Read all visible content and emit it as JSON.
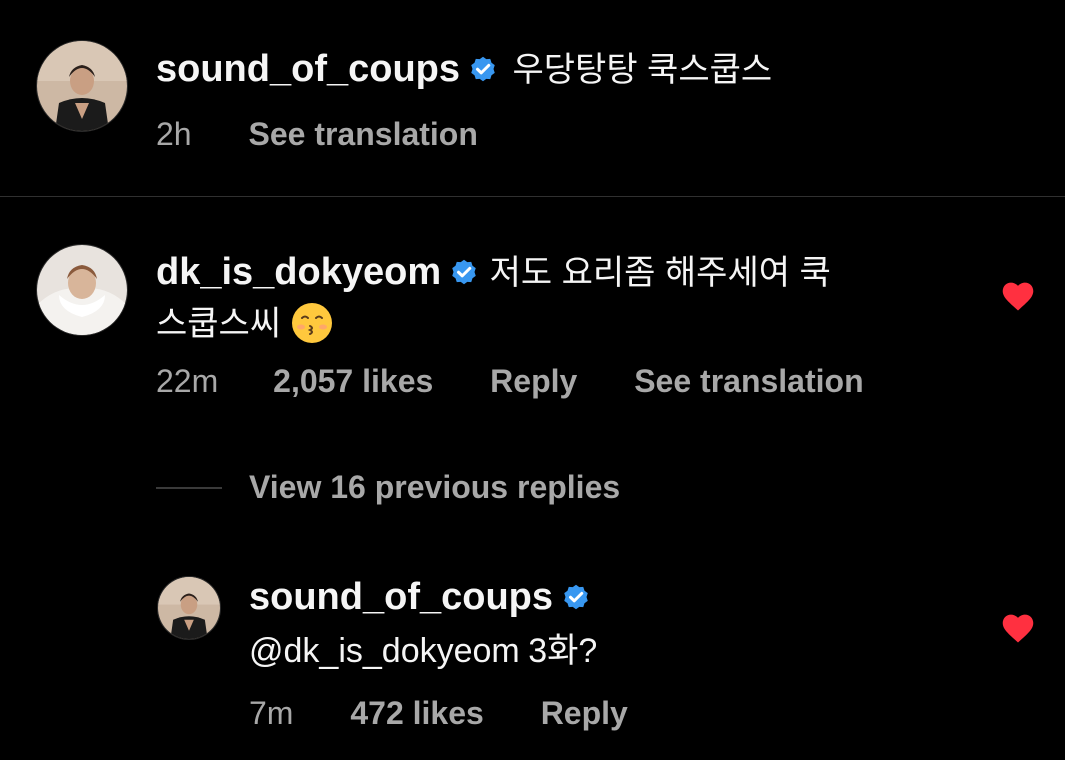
{
  "caption": {
    "username": "sound_of_coups",
    "text": "우당탕탕 쿡스쿱스",
    "time": "2h",
    "see_translation": "See translation",
    "avatar_icon": "avatar-person-icon",
    "verified_icon": "verified-badge-icon"
  },
  "comment": {
    "username": "dk_is_dokyeom",
    "text_line1": "저도 요리좀 해주세여 쿡",
    "text_line2": "스쿱스씨",
    "emoji": "kissing-face-emoji",
    "time": "22m",
    "likes": "2,057 likes",
    "reply": "Reply",
    "see_translation": "See translation",
    "liked": true
  },
  "view_replies": {
    "label": "View 16 previous replies"
  },
  "reply": {
    "username": "sound_of_coups",
    "mention": "@dk_is_dokyeom",
    "text": "3화?",
    "time": "7m",
    "likes": "472 likes",
    "reply": "Reply",
    "liked": true
  },
  "colors": {
    "background": "#000000",
    "text_primary": "#f5f5f5",
    "text_secondary": "#a8a8a8",
    "verified": "#3897f0",
    "heart": "#ff3040",
    "divider": "#303030"
  }
}
